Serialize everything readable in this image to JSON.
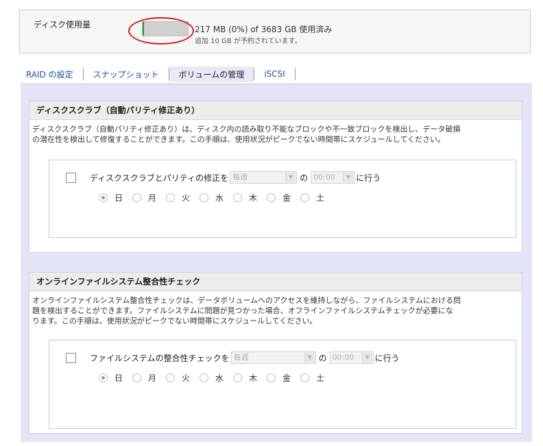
{
  "usage": {
    "label": "ディスク使用量",
    "used_fraction": 0.0,
    "text": "217 MB (0%) of 3683 GB 使用済み",
    "note": "追加 10 GB が予約されています。"
  },
  "tabs": [
    {
      "label": "RAID の設定"
    },
    {
      "label": "スナップショット"
    },
    {
      "label": "ボリュームの管理",
      "active": true
    },
    {
      "label": "iSCSI"
    }
  ],
  "scrub": {
    "title": "ディスクスクラブ（自動パリティ修正あり）",
    "desc_line1": "ディスクスクラブ（自動パリティ修正あり）は、ディスク内の読み取り不能なブロックや不一致ブロックを検出し、データ破損",
    "desc_line2": "の潜在性を検出して修復することができます。この手順は、使用状況がピークでない時間帯にスケジュールしてください。",
    "label": "ディスクスクラブとパリティの修正を",
    "frequency": "毎週",
    "of": "の",
    "time": "00:00",
    "suffix": "に行う",
    "days": [
      "日",
      "月",
      "火",
      "水",
      "木",
      "金",
      "土"
    ],
    "selected_day": "日"
  },
  "fscheck": {
    "title": "オンラインファイルシステム整合性チェック",
    "desc_line1": "オンラインファイルシステム整合性チェックは、データボリュームへのアクセスを維持しながら、ファイルシステムにおける問",
    "desc_line2": "題を検出することができます。ファイルシステムに問題が見つかった場合、オフラインファイルシステムチェックが必要にな",
    "desc_line3": "ります。この手順は、使用状況がピークでない時間帯にスケジュールしてください。",
    "label": "ファイルシステムの整合性チェックを",
    "frequency": "毎週",
    "of": "の",
    "time": "00:00",
    "suffix": "に行う",
    "days": [
      "日",
      "月",
      "火",
      "水",
      "木",
      "金",
      "土"
    ],
    "selected_day": "日"
  }
}
